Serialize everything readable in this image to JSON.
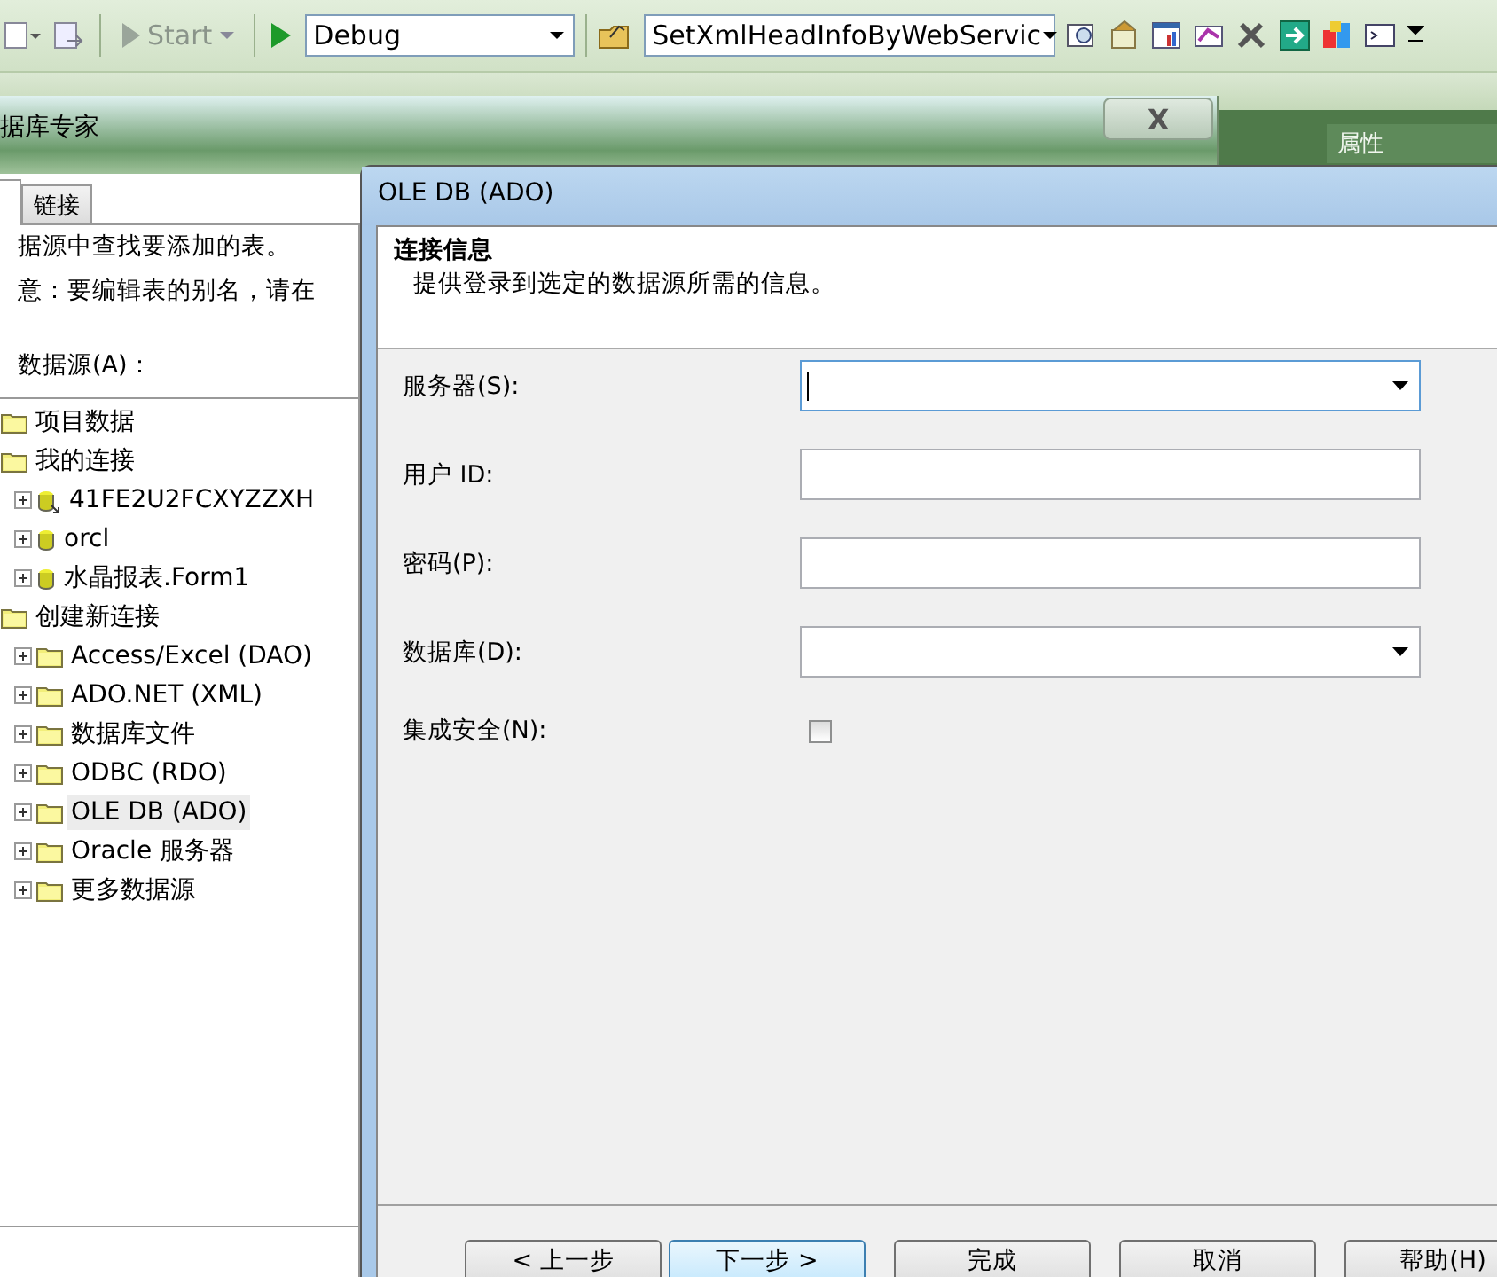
{
  "toolbar": {
    "start_label": "Start",
    "configuration": "Debug",
    "project": "SetXmlHeadInfoByWebServic"
  },
  "properties_panel": {
    "title": "属性"
  },
  "background_window": {
    "title": "据库专家",
    "close_label": "X",
    "tabs": [
      {
        "selected": true
      },
      {
        "label": "链接",
        "selected": false
      }
    ],
    "instructions": [
      "据源中查找要添加的表。",
      "意：要编辑表的别名，请在"
    ],
    "sources_label": "数据源(A)：",
    "tree": [
      {
        "label": "项目数据",
        "kind": "folder",
        "selected": false
      },
      {
        "label": "我的连接",
        "kind": "folder",
        "selected": false,
        "children": [
          {
            "label": "41FE2U2FCXYZZXH",
            "kind": "server",
            "selected": false
          },
          {
            "label": "orcl",
            "kind": "database",
            "selected": false
          },
          {
            "label": "水晶报表.Form1",
            "kind": "database",
            "selected": false
          }
        ]
      },
      {
        "label": "创建新连接",
        "kind": "folder",
        "selected": false,
        "children": [
          {
            "label": "Access/Excel (DAO)",
            "kind": "folder",
            "selected": false
          },
          {
            "label": "ADO.NET (XML)",
            "kind": "folder",
            "selected": false
          },
          {
            "label": "数据库文件",
            "kind": "folder",
            "selected": false
          },
          {
            "label": "ODBC (RDO)",
            "kind": "folder",
            "selected": false
          },
          {
            "label": "OLE DB (ADO)",
            "kind": "folder",
            "selected": true
          },
          {
            "label": "Oracle 服务器",
            "kind": "folder",
            "selected": false
          },
          {
            "label": "更多数据源",
            "kind": "folder",
            "selected": false
          }
        ]
      }
    ]
  },
  "dialog": {
    "title": "OLE DB (ADO)",
    "heading": "连接信息",
    "subheading": "提供登录到选定的数据源所需的信息。",
    "fields": [
      {
        "label": "服务器(S):",
        "kind": "combo",
        "focused": true
      },
      {
        "label": "用户 ID:",
        "kind": "text",
        "focused": false
      },
      {
        "label": "密码(P):",
        "kind": "text",
        "focused": false
      },
      {
        "label": "数据库(D):",
        "kind": "combo",
        "focused": false
      },
      {
        "label": "集成安全(N):",
        "kind": "checkbox",
        "checked": false
      }
    ],
    "buttons": [
      {
        "label": "< 上一步",
        "default": false
      },
      {
        "label": "下一步 >",
        "default": true
      },
      {
        "label": "完成",
        "default": false
      },
      {
        "label": "取消",
        "default": false
      },
      {
        "label": "帮助(H)",
        "default": false
      }
    ]
  }
}
